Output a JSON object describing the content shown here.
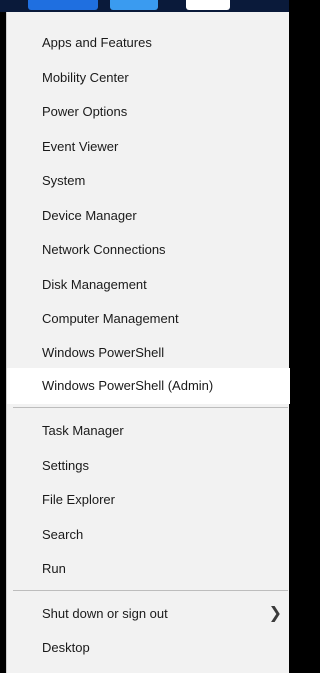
{
  "menu": {
    "group1": [
      "Apps and Features",
      "Mobility Center",
      "Power Options",
      "Event Viewer",
      "System",
      "Device Manager",
      "Network Connections",
      "Disk Management",
      "Computer Management",
      "Windows PowerShell",
      "Windows PowerShell (Admin)"
    ],
    "group2": [
      "Task Manager",
      "Settings",
      "File Explorer",
      "Search",
      "Run"
    ],
    "group3": [
      "Shut down or sign out",
      "Desktop"
    ],
    "highlighted_item": "Windows PowerShell (Admin)"
  },
  "icons": {
    "submenu": "chevron-right-icon"
  }
}
